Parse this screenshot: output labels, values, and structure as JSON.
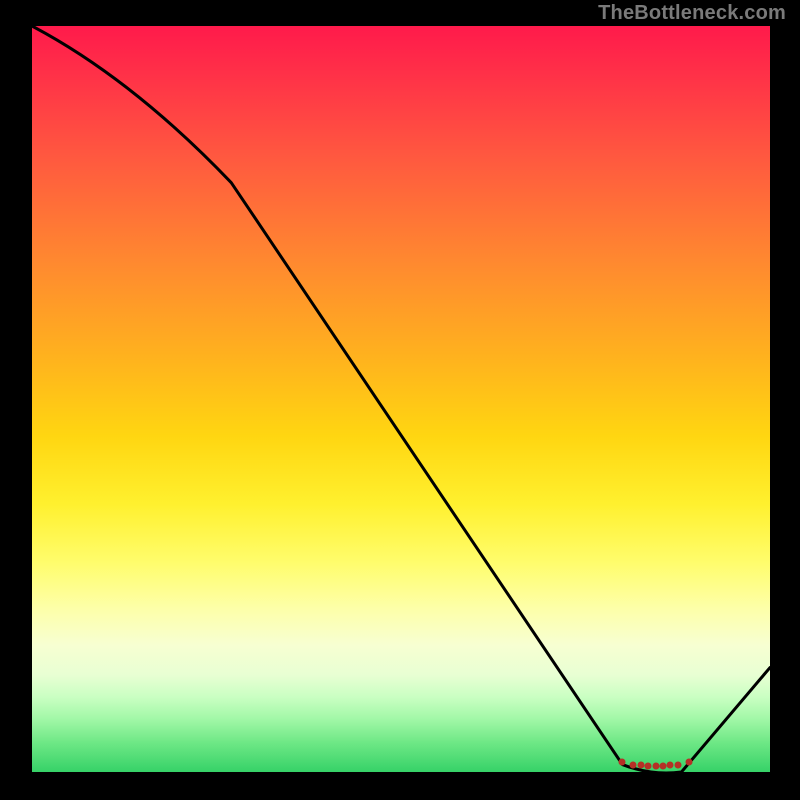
{
  "watermark": "TheBottleneck.com",
  "chart_data": {
    "type": "line",
    "title": "",
    "xlabel": "",
    "ylabel": "",
    "xlim": [
      0,
      100
    ],
    "ylim": [
      0,
      100
    ],
    "grid": false,
    "series": [
      {
        "name": "curve",
        "x": [
          0,
          27,
          80,
          88,
          100
        ],
        "values": [
          100,
          79,
          1,
          0,
          14
        ]
      },
      {
        "name": "markers",
        "x": [
          80,
          81.5,
          82.5,
          83.5,
          84.5,
          85.5,
          86.5,
          87.5,
          89
        ],
        "values": [
          1.4,
          1.0,
          0.9,
          0.8,
          0.8,
          0.8,
          0.9,
          1.0,
          1.4
        ]
      }
    ],
    "colors": {
      "curve": "#000000",
      "markers": "#b53026",
      "gradient_top": "#ff1a4b",
      "gradient_mid": "#fff02e",
      "gradient_bottom": "#36d268"
    }
  }
}
